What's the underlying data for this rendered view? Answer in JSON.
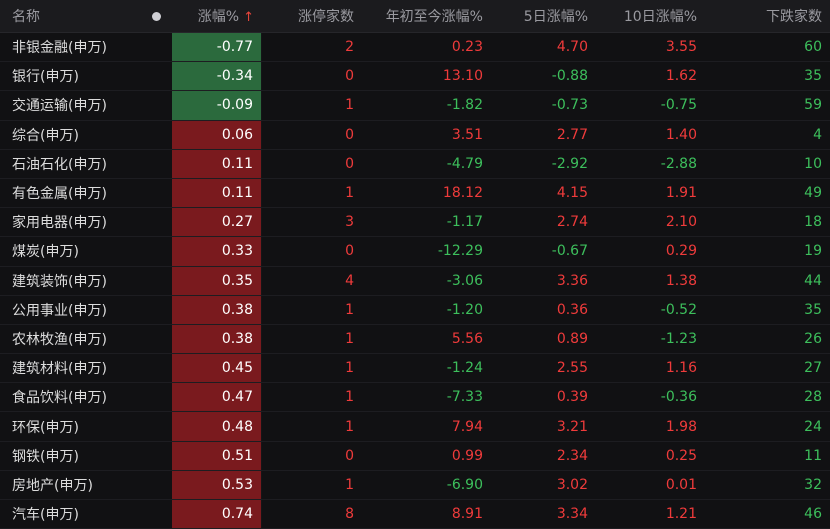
{
  "header": {
    "name": "名称",
    "change": "涨幅%",
    "sort_arrow": "↑",
    "limit_up": "涨停家数",
    "ytd": "年初至今涨幅%",
    "d5": "5日涨幅%",
    "d10": "10日涨幅%",
    "decliners": "下跌家数"
  },
  "colors": {
    "up": "#ef3b3b",
    "down": "#3dbf5c",
    "up_bg": "#7a1a1e",
    "down_bg": "#2b6a3d"
  },
  "rows": [
    {
      "name": "非银金融(申万)",
      "change": "-0.77",
      "limit_up": "2",
      "ytd": "0.23",
      "d5": "4.70",
      "d10": "3.55",
      "decliners": "60"
    },
    {
      "name": "银行(申万)",
      "change": "-0.34",
      "limit_up": "0",
      "ytd": "13.10",
      "d5": "-0.88",
      "d10": "1.62",
      "decliners": "35"
    },
    {
      "name": "交通运输(申万)",
      "change": "-0.09",
      "limit_up": "1",
      "ytd": "-1.82",
      "d5": "-0.73",
      "d10": "-0.75",
      "decliners": "59"
    },
    {
      "name": "综合(申万)",
      "change": "0.06",
      "limit_up": "0",
      "ytd": "3.51",
      "d5": "2.77",
      "d10": "1.40",
      "decliners": "4"
    },
    {
      "name": "石油石化(申万)",
      "change": "0.11",
      "limit_up": "0",
      "ytd": "-4.79",
      "d5": "-2.92",
      "d10": "-2.88",
      "decliners": "10"
    },
    {
      "name": "有色金属(申万)",
      "change": "0.11",
      "limit_up": "1",
      "ytd": "18.12",
      "d5": "4.15",
      "d10": "1.91",
      "decliners": "49"
    },
    {
      "name": "家用电器(申万)",
      "change": "0.27",
      "limit_up": "3",
      "ytd": "-1.17",
      "d5": "2.74",
      "d10": "2.10",
      "decliners": "18"
    },
    {
      "name": "煤炭(申万)",
      "change": "0.33",
      "limit_up": "0",
      "ytd": "-12.29",
      "d5": "-0.67",
      "d10": "0.29",
      "decliners": "19"
    },
    {
      "name": "建筑装饰(申万)",
      "change": "0.35",
      "limit_up": "4",
      "ytd": "-3.06",
      "d5": "3.36",
      "d10": "1.38",
      "decliners": "44"
    },
    {
      "name": "公用事业(申万)",
      "change": "0.38",
      "limit_up": "1",
      "ytd": "-1.20",
      "d5": "0.36",
      "d10": "-0.52",
      "decliners": "35"
    },
    {
      "name": "农林牧渔(申万)",
      "change": "0.38",
      "limit_up": "1",
      "ytd": "5.56",
      "d5": "0.89",
      "d10": "-1.23",
      "decliners": "26"
    },
    {
      "name": "建筑材料(申万)",
      "change": "0.45",
      "limit_up": "1",
      "ytd": "-1.24",
      "d5": "2.55",
      "d10": "1.16",
      "decliners": "27"
    },
    {
      "name": "食品饮料(申万)",
      "change": "0.47",
      "limit_up": "1",
      "ytd": "-7.33",
      "d5": "0.39",
      "d10": "-0.36",
      "decliners": "28"
    },
    {
      "name": "环保(申万)",
      "change": "0.48",
      "limit_up": "1",
      "ytd": "7.94",
      "d5": "3.21",
      "d10": "1.98",
      "decliners": "24"
    },
    {
      "name": "钢铁(申万)",
      "change": "0.51",
      "limit_up": "0",
      "ytd": "0.99",
      "d5": "2.34",
      "d10": "0.25",
      "decliners": "11"
    },
    {
      "name": "房地产(申万)",
      "change": "0.53",
      "limit_up": "1",
      "ytd": "-6.90",
      "d5": "3.02",
      "d10": "0.01",
      "decliners": "32"
    },
    {
      "name": "汽车(申万)",
      "change": "0.74",
      "limit_up": "8",
      "ytd": "8.91",
      "d5": "3.34",
      "d10": "1.21",
      "decliners": "46"
    }
  ]
}
